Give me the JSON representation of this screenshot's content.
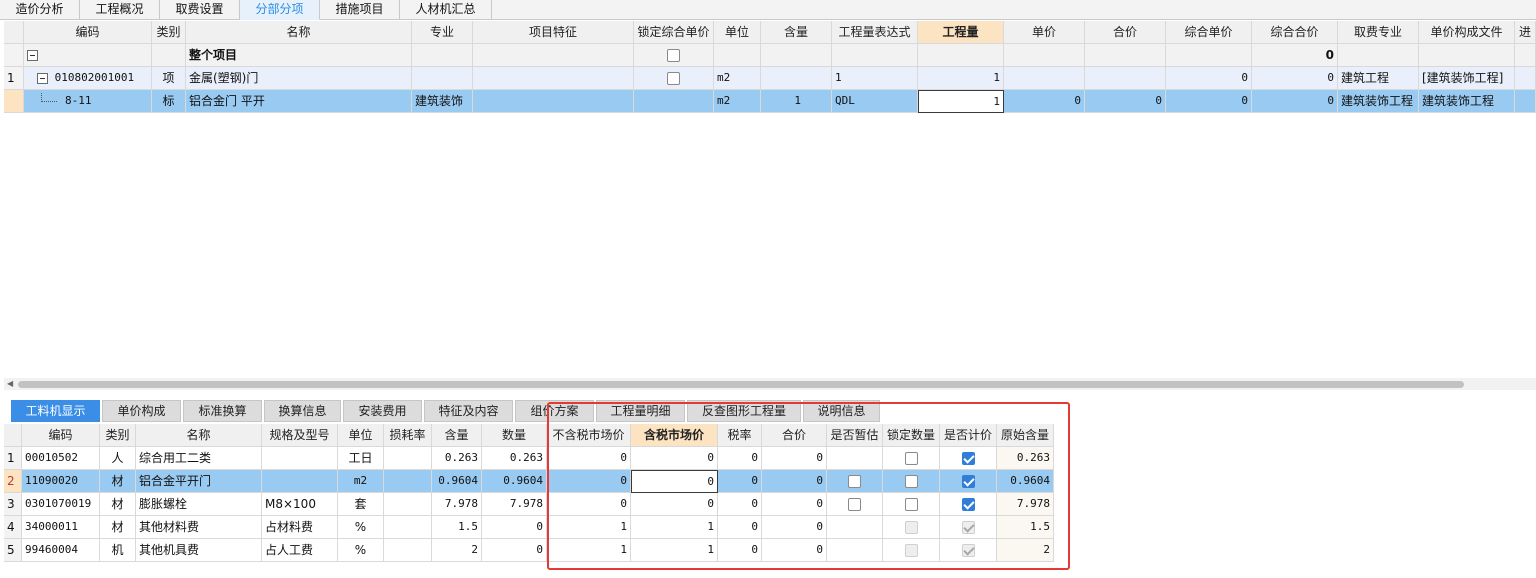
{
  "top_tabs": [
    "造价分析",
    "工程概况",
    "取费设置",
    "分部分项",
    "措施项目",
    "人材机汇总"
  ],
  "top_tabs_active": 3,
  "upper_grid": {
    "headers": [
      "编码",
      "类别",
      "名称",
      "专业",
      "项目特征",
      "锁定综合单价",
      "单位",
      "含量",
      "工程量表达式",
      "工程量",
      "单价",
      "合价",
      "综合单价",
      "综合合价",
      "取费专业",
      "单价构成文件",
      "进"
    ],
    "group_row": {
      "name": "整个项目",
      "total": "0"
    },
    "rows": [
      {
        "rownum": "1",
        "code": "010802001001",
        "type": "项",
        "name": "金属(塑钢)门",
        "major": "",
        "feature": "",
        "unit": "m2",
        "content": "",
        "expr": "1",
        "qty": "1",
        "price": "",
        "amount": "",
        "comp_price": "0",
        "comp_amount": "0",
        "fee_major": "建筑工程",
        "price_file": "[建筑装饰工程]"
      },
      {
        "rownum": "",
        "code": "8-11",
        "type": "标",
        "name": "铝合金门 平开",
        "major": "建筑装饰",
        "feature": "",
        "unit": "m2",
        "content": "1",
        "expr": "QDL",
        "qty": "1",
        "price": "0",
        "amount": "0",
        "comp_price": "0",
        "comp_amount": "0",
        "fee_major": "建筑装饰工程",
        "price_file": "建筑装饰工程"
      }
    ]
  },
  "bottom_tabs": [
    "工料机显示",
    "单价构成",
    "标准换算",
    "换算信息",
    "安装费用",
    "特征及内容",
    "组价方案",
    "工程量明细",
    "反查图形工程量",
    "说明信息"
  ],
  "bottom_tabs_active": 0,
  "lower_grid": {
    "headers": [
      "编码",
      "类别",
      "名称",
      "规格及型号",
      "单位",
      "损耗率",
      "含量",
      "数量",
      "不含税市场价",
      "含税市场价",
      "税率",
      "合价",
      "是否暂估",
      "锁定数量",
      "是否计价",
      "原始含量"
    ],
    "rows": [
      {
        "rownum": "1",
        "code": "00010502",
        "type": "人",
        "name": "综合用工二类",
        "spec": "",
        "unit": "工日",
        "loss": "",
        "content": "0.263",
        "qty": "0.263",
        "price_ex": "0",
        "price_in": "0",
        "tax": "0",
        "amount": "0",
        "est": "none",
        "lock": "off",
        "priced": "on",
        "orig": "0.263"
      },
      {
        "rownum": "2",
        "code": "11090020",
        "type": "材",
        "name": "铝合金平开门",
        "spec": "",
        "unit": "m2",
        "loss": "",
        "content": "0.9604",
        "qty": "0.9604",
        "price_ex": "0",
        "price_in": "0",
        "tax": "0",
        "amount": "0",
        "est": "off",
        "lock": "off",
        "priced": "on",
        "orig": "0.9604"
      },
      {
        "rownum": "3",
        "code": "0301070019",
        "type": "材",
        "name": "膨胀螺栓",
        "spec": "M8×100",
        "unit": "套",
        "loss": "",
        "content": "7.978",
        "qty": "7.978",
        "price_ex": "0",
        "price_in": "0",
        "tax": "0",
        "amount": "0",
        "est": "off",
        "lock": "off",
        "priced": "on",
        "orig": "7.978"
      },
      {
        "rownum": "4",
        "code": "34000011",
        "type": "材",
        "name": "其他材料费",
        "spec": "占材料费",
        "unit": "%",
        "loss": "",
        "content": "1.5",
        "qty": "0",
        "price_ex": "1",
        "price_in": "1",
        "tax": "0",
        "amount": "0",
        "est": "none",
        "lock": "disabled",
        "priced": "disabled-on",
        "orig": "1.5"
      },
      {
        "rownum": "5",
        "code": "99460004",
        "type": "机",
        "name": "其他机具费",
        "spec": "占人工费",
        "unit": "%",
        "loss": "",
        "content": "2",
        "qty": "0",
        "price_ex": "1",
        "price_in": "1",
        "tax": "0",
        "amount": "0",
        "est": "none",
        "lock": "disabled",
        "priced": "disabled-on",
        "orig": "2"
      }
    ]
  },
  "colors": {
    "accent": "#3a8ee6",
    "selected_row": "#99caf2",
    "highlight_box": "#e53935",
    "active_header": "#fce4c2"
  }
}
